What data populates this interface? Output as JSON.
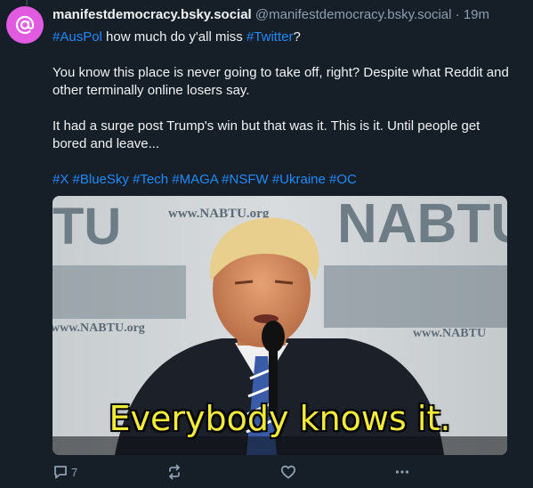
{
  "post": {
    "display_name": "manifestdemocracy.bsky.social",
    "handle": "@manifestdemocracy.bsky.social",
    "separator": "·",
    "time": "19m",
    "line1": {
      "tag1": "#AusPol",
      "text1": " how much do y'all miss ",
      "tag2": "#Twitter",
      "text2": "?"
    },
    "paragraph2": "You know this place is never going to take off, right? Despite what Reddit and other terminally online losers say.",
    "paragraph3": "It had a surge post Trump's win but that was it. This is it. Until people get bored and leave...",
    "hashtags": [
      "#X",
      "#BlueSky",
      "#Tech",
      "#MAGA",
      "#NSFW",
      "#Ukraine",
      "#OC"
    ]
  },
  "media": {
    "caption": "Everybody knows it.",
    "backdrop_text_1": "www.NABTU.org",
    "backdrop_text_2": "NABTU",
    "backdrop_text_3": "www.NABTU.org",
    "backdrop_text_4": "www.NABTU"
  },
  "actions": {
    "reply_count": "7",
    "icons": [
      "reply-icon",
      "repost-icon",
      "like-icon",
      "more-icon"
    ]
  },
  "colors": {
    "background": "#161e27",
    "link": "#208bfe",
    "muted": "#8d9fb1",
    "avatar": "#e05be0"
  }
}
